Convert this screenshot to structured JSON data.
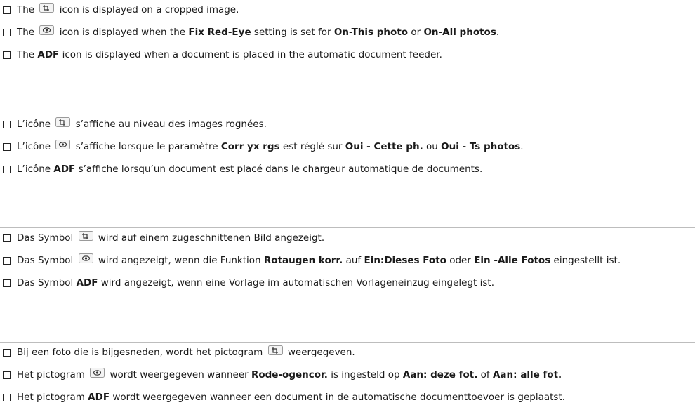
{
  "sections": [
    {
      "lang": "en",
      "items": [
        {
          "parts": [
            "The ",
            {
              "icon": "crop-icon"
            },
            " icon is displayed on a cropped image."
          ]
        },
        {
          "parts": [
            "The ",
            {
              "icon": "red-eye-icon"
            },
            " icon is displayed when the ",
            {
              "b": "Fix Red-Eye"
            },
            " setting is set for ",
            {
              "b": "On-This photo"
            },
            " or ",
            {
              "b": "On-All photos"
            },
            "."
          ]
        },
        {
          "parts": [
            "The ",
            {
              "b": "ADF"
            },
            " icon is displayed when a document is placed in the automatic document feeder."
          ]
        }
      ]
    },
    {
      "lang": "fr",
      "items": [
        {
          "parts": [
            "L’icône ",
            {
              "icon": "crop-icon"
            },
            " s’affiche au niveau des images rognées."
          ]
        },
        {
          "parts": [
            "L’icône ",
            {
              "icon": "red-eye-icon"
            },
            " s’affiche lorsque le paramètre ",
            {
              "b": "Corr yx rgs"
            },
            " est réglé sur ",
            {
              "b": "Oui - Cette ph."
            },
            " ou ",
            {
              "b": "Oui - Ts photos"
            },
            "."
          ]
        },
        {
          "parts": [
            "L’icône ",
            {
              "b": "ADF"
            },
            " s’affiche lorsqu’un document est placé dans le chargeur automatique de documents."
          ]
        }
      ]
    },
    {
      "lang": "de",
      "items": [
        {
          "parts": [
            "Das Symbol ",
            {
              "icon": "crop-icon"
            },
            " wird auf einem zugeschnittenen Bild angezeigt."
          ]
        },
        {
          "parts": [
            "Das Symbol ",
            {
              "icon": "red-eye-icon"
            },
            " wird angezeigt, wenn die Funktion ",
            {
              "b": "Rotaugen korr."
            },
            " auf ",
            {
              "b": "Ein:Dieses Foto"
            },
            " oder ",
            {
              "b": "Ein -Alle Fotos"
            },
            " eingestellt ist."
          ]
        },
        {
          "parts": [
            "Das Symbol ",
            {
              "b": "ADF"
            },
            " wird angezeigt, wenn eine Vorlage im automatischen Vorlageneinzug eingelegt ist."
          ]
        }
      ]
    },
    {
      "lang": "nl",
      "items": [
        {
          "parts": [
            "Bij een foto die is bijgesneden, wordt het pictogram ",
            {
              "icon": "crop-icon"
            },
            " weergegeven."
          ]
        },
        {
          "parts": [
            "Het pictogram ",
            {
              "icon": "red-eye-icon"
            },
            " wordt weergegeven wanneer ",
            {
              "b": "Rode-ogencor."
            },
            " is ingesteld op ",
            {
              "b": "Aan: deze fot."
            },
            " of ",
            {
              "b": "Aan: alle fot."
            }
          ]
        },
        {
          "parts": [
            "Het pictogram ",
            {
              "b": "ADF"
            },
            " wordt weergegeven wanneer een document in de automatische documenttoevoer is geplaatst."
          ]
        }
      ]
    }
  ]
}
